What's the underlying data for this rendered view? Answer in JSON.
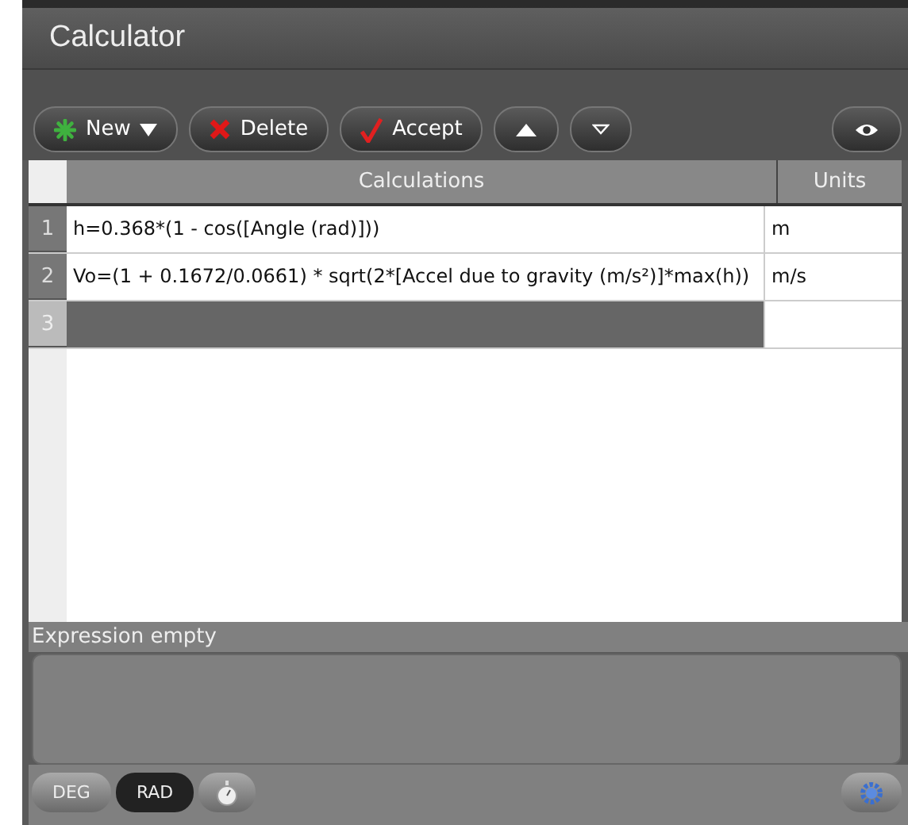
{
  "window": {
    "title": "Calculator"
  },
  "toolbar": {
    "new": "New",
    "delete": "Delete",
    "accept": "Accept"
  },
  "table": {
    "columns": [
      "Calculations",
      "Units"
    ],
    "rows": [
      {
        "number": "1",
        "calculation": "h=0.368*(1 - cos([Angle (rad)]))",
        "units": "m",
        "selected": false
      },
      {
        "number": "2",
        "calculation": "Vo=(1 + 0.1672/0.0661) * sqrt(2*[Accel due to gravity (m/s²)]*max(h))",
        "units": "m/s",
        "selected": false
      },
      {
        "number": "3",
        "selected": true
      }
    ]
  },
  "expression": {
    "status": "Expression empty"
  },
  "modes": [
    {
      "label": "DEG",
      "selected": false
    },
    {
      "label": "RAD",
      "selected": true
    }
  ]
}
